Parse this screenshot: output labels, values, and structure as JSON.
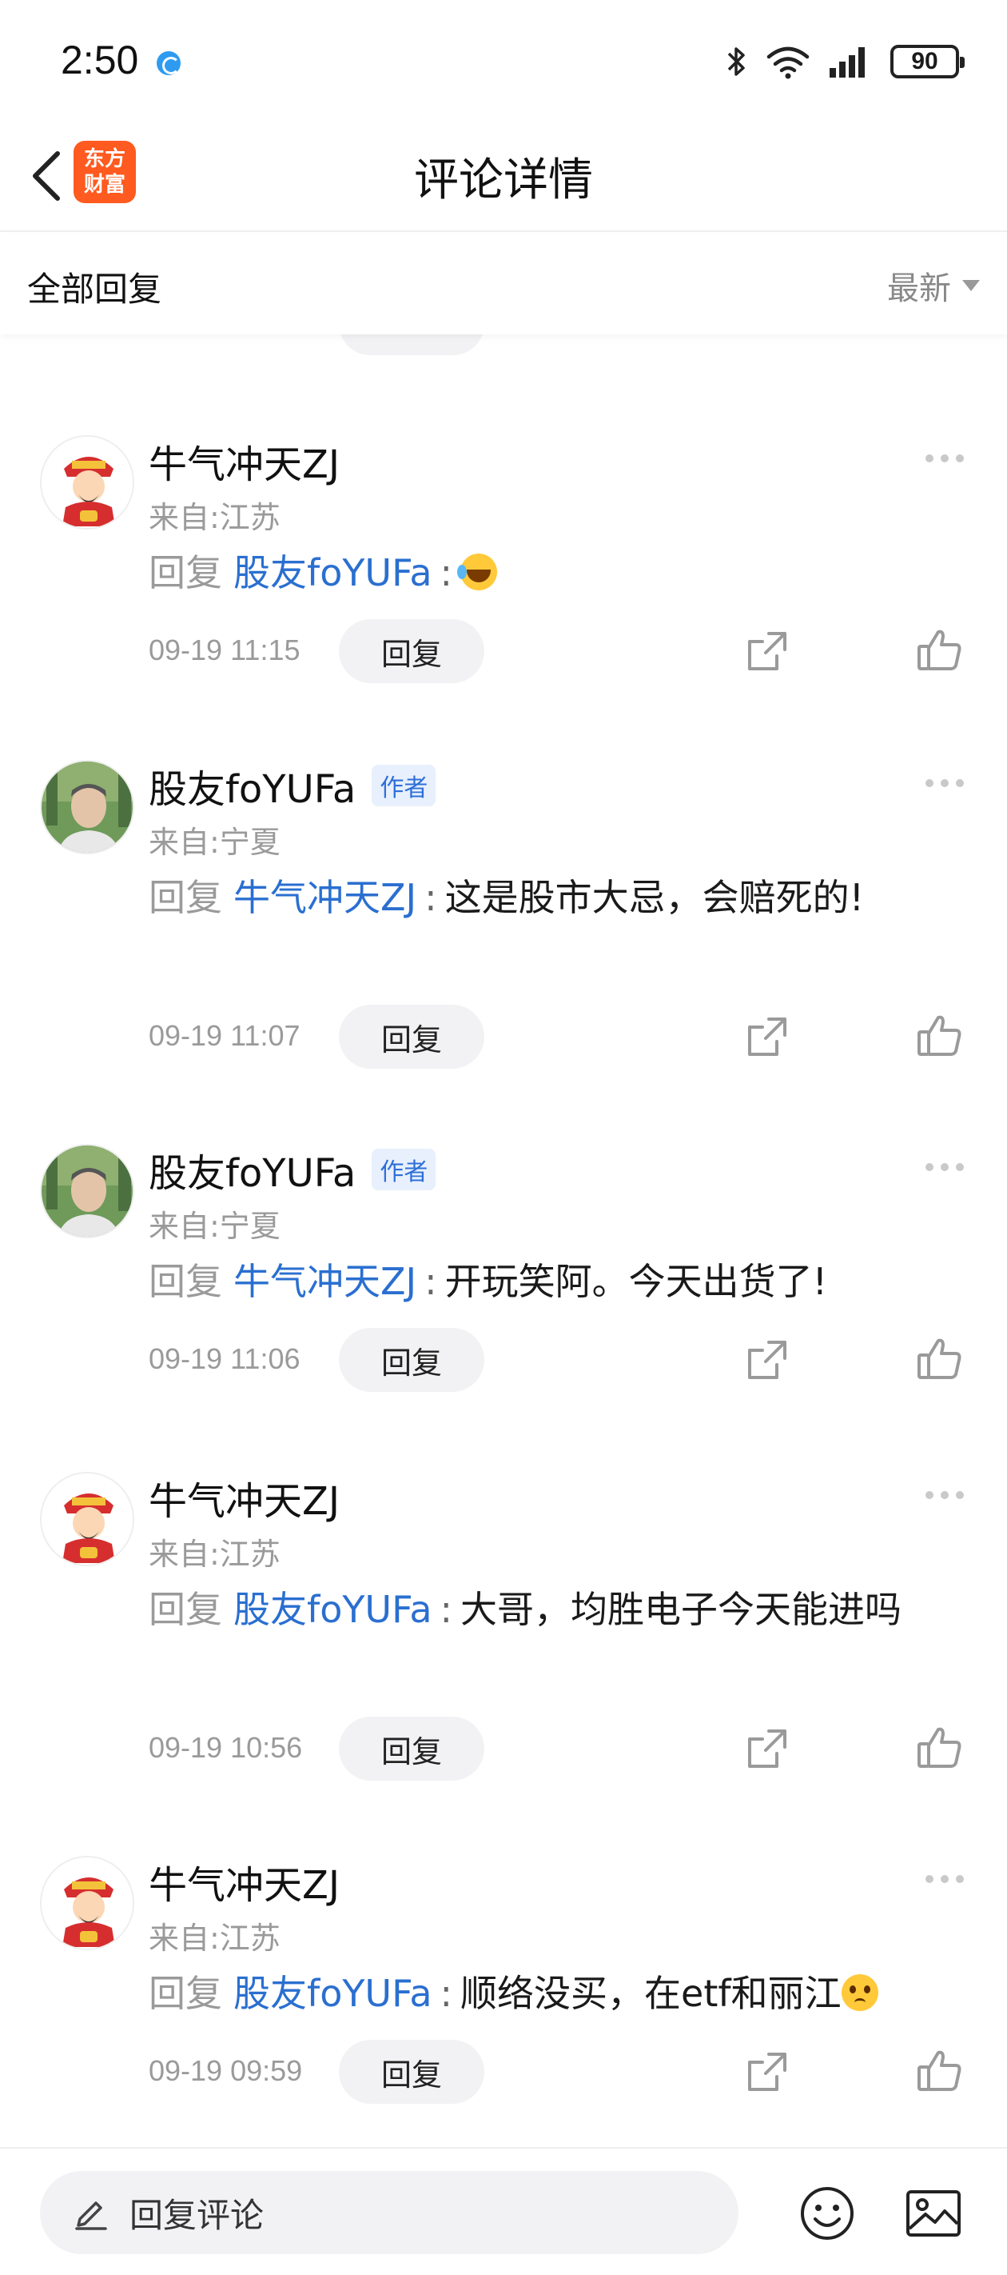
{
  "status_bar": {
    "time": "2:50",
    "battery": "90"
  },
  "header": {
    "logo_line1": "东方",
    "logo_line2": "财富",
    "title": "评论详情"
  },
  "sort_bar": {
    "all_replies": "全部回复",
    "sort_label": "最新"
  },
  "reply_button_label": "回复",
  "reply_word": "回复",
  "comments": [
    {
      "username": "牛气冲天ZJ",
      "is_author": false,
      "location": "来自:江苏",
      "reply_to": "股友foYUFa",
      "text": "",
      "emoji": "laugh-tears",
      "timestamp": "09-19 11:15"
    },
    {
      "username": "股友foYUFa",
      "is_author": true,
      "author_badge": "作者",
      "location": "来自:宁夏",
      "reply_to": "牛气冲天ZJ",
      "text": "这是股市大忌，会赔死的!",
      "timestamp": "09-19 11:07"
    },
    {
      "username": "股友foYUFa",
      "is_author": true,
      "author_badge": "作者",
      "location": "来自:宁夏",
      "reply_to": "牛气冲天ZJ",
      "text": "开玩笑阿。今天出货了!",
      "timestamp": "09-19 11:06"
    },
    {
      "username": "牛气冲天ZJ",
      "is_author": false,
      "location": "来自:江苏",
      "reply_to": "股友foYUFa",
      "text": "大哥，均胜电子今天能进吗",
      "timestamp": "09-19 10:56"
    },
    {
      "username": "牛气冲天ZJ",
      "is_author": false,
      "location": "来自:江苏",
      "reply_to": "股友foYUFa",
      "text": "顺络没买，在etf和丽江",
      "emoji": "pleading",
      "timestamp": "09-19 09:59"
    }
  ],
  "bottom_bar": {
    "reply_placeholder": "回复评论"
  },
  "colors": {
    "brand": "#ff5a1f",
    "mention": "#2a6fd0",
    "author_badge_bg": "#e7f0fc",
    "muted": "#9a9a9a"
  }
}
